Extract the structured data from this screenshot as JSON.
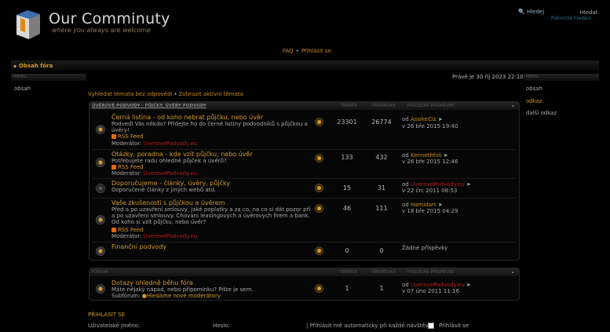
{
  "header": {
    "site_title": "Our Comminuty",
    "site_desc": "where you always are welcome",
    "search_link": "Hledej",
    "search_placeholder": "Hledat",
    "adv_search": "Pokročilé hledání"
  },
  "nav": {
    "faq": "FAQ",
    "login": "Přihlásit se"
  },
  "breadcrumb": "Obsah fóra",
  "left_menu": {
    "heading": "MENU",
    "item": "obsah"
  },
  "right_menu": {
    "heading": "MENU",
    "items": [
      "obsah",
      "odkaz",
      "další odkaz"
    ]
  },
  "date": "Právě je 30 říj 2023 22:10",
  "quick_links": {
    "unanswered": "Vyhledat témata bez odpovědí",
    "active": "Zobrazit aktivní témata"
  },
  "category1": {
    "name": "ÚVĚROVÉ PODVODY - PŮJČKY, ÚVĚRY PODVODY",
    "col_topics": "TÉMATA",
    "col_posts": "PŘÍSPĚVKY",
    "col_last": "POSLEDNÍ PŘÍSPĚVEK",
    "forums": [
      {
        "title": "Černá listina - od koho nebrat půjčku, nebo úvěr",
        "desc": "Podvedl Vás někdo? Přidejte ho do černé listiny podvodníků s půjčkou a úvěry!",
        "rss": "RSS Feed",
        "mod_label": "Moderátor:",
        "mod": "UverovePodvody.eu",
        "topics": "23301",
        "posts": "26774",
        "by_label": "od",
        "last_user": "AssikeCiz",
        "last_date": "v 26 bře 2015 19:40"
      },
      {
        "title": "Otázky, poradna - kde vzít půjčku, nebo úvěr",
        "desc": "Potřebujete radu ohledně půjček a úvěrů?",
        "rss": "RSS Feed",
        "mod_label": "Moderátor:",
        "mod": "UverovePodvody.eu",
        "topics": "133",
        "posts": "432",
        "by_label": "od",
        "last_user": "Kennethfoli",
        "last_date": "v 26 bře 2015 12:46"
      },
      {
        "title": "Doporučujeme - články, úvěry, půjčky",
        "desc": "Doporučené články z jiných webů atd.",
        "topics": "15",
        "posts": "31",
        "by_label": "od",
        "last_user": "UverovePodvody.eu",
        "last_date": "v 22 črc 2011 08:53"
      },
      {
        "title": "Vaše zkušenosti s půjčkou a úvěrem",
        "desc": "Před a po uzavření smlouvy, jaké poplatky a za co, na co si dát pozor při a po uzavření smlouvy. Chování leasingových a úvěrových firem a bank. Od koho si vzít půjčku, nebo úvěr?",
        "rss": "RSS Feed",
        "mod_label": "Moderátor:",
        "mod": "UverovePodvody.eu",
        "topics": "46",
        "posts": "111",
        "by_label": "od",
        "last_user": "Hamidart",
        "last_date": "v 18 bře 2015 04:29"
      },
      {
        "title": "Finanční podvody",
        "topics": "0",
        "posts": "0",
        "last_none": "Žádné příspěvky"
      }
    ]
  },
  "category2": {
    "name": "FÓRUM",
    "col_topics": "TÉMATA",
    "col_posts": "PŘÍSPĚVKY",
    "col_last": "POSLEDNÍ PŘÍSPĚVEK",
    "forum": {
      "title": "Dotazy ohledně běhu fóra",
      "desc": "Máte nějaký nápad, nebo připomínku? Pište je sem.",
      "sub_label": "Subfórum:",
      "sub": "Hledáme nové moderátory",
      "topics": "1",
      "posts": "1",
      "by_label": "od",
      "last_user": "UverovePodvody.eu",
      "last_date": "v 07 úno 2011 11:16"
    }
  },
  "login": {
    "title": "PŘIHLÁSIT SE",
    "user_label": "Uživatelské jméno:",
    "pass_label": "Heslo:",
    "auto_label": "| Přihlásit mě automaticky při každé návštěvě",
    "button": "Přihlásit se"
  }
}
